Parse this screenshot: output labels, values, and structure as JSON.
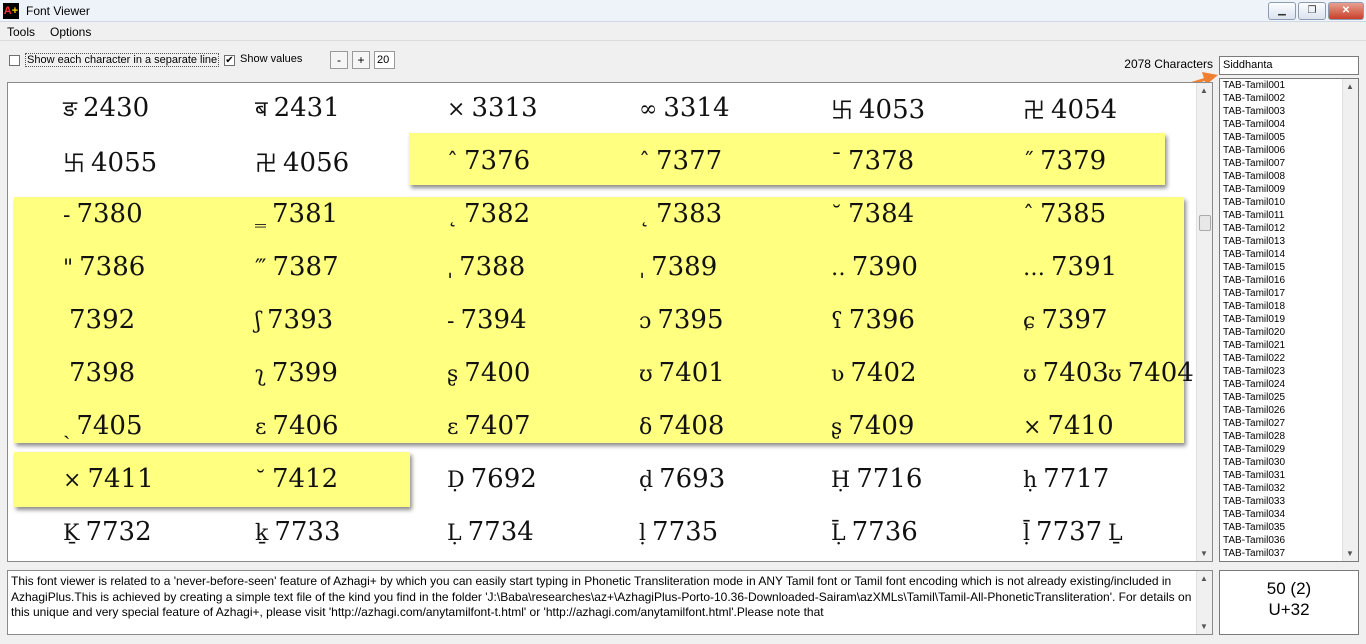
{
  "window": {
    "title": "Font Viewer",
    "app_icon": "A+"
  },
  "menu": [
    "Tools",
    "Options"
  ],
  "toolbar": {
    "separate_line_label": "Show each character in a separate line",
    "separate_line_checked": false,
    "show_values_label": "Show values",
    "show_values_checked": true,
    "minus_label": "-",
    "plus_label": "+",
    "font_size": "20"
  },
  "char_count": "2078 Characters",
  "font_name": "Siddhanta",
  "colors": {
    "highlight": "#ffff80",
    "arrow": "#f08030"
  },
  "rows": [
    [
      [
        "ङ",
        "2430"
      ],
      [
        "ब",
        "2431"
      ],
      [
        "⨯",
        "3313"
      ],
      [
        "∞",
        "3314"
      ],
      [
        "卐",
        "4053"
      ],
      [
        "卍",
        "4054"
      ]
    ],
    [
      [
        "卐",
        "4055"
      ],
      [
        "卍",
        "4056"
      ],
      [
        "ˆ",
        "7376"
      ],
      [
        "ˆ",
        "7377"
      ],
      [
        "ˉ",
        "7378"
      ],
      [
        "˝",
        "7379"
      ]
    ],
    [
      [
        "-",
        "7380"
      ],
      [
        "‗",
        "7381"
      ],
      [
        "˛",
        "7382"
      ],
      [
        "˛",
        "7383"
      ],
      [
        "˘",
        "7384"
      ],
      [
        "ˆ",
        "7385"
      ]
    ],
    [
      [
        "\"",
        "7386"
      ],
      [
        "‴",
        "7387"
      ],
      [
        "ˌ",
        "7388"
      ],
      [
        "ˌ",
        "7389"
      ],
      [
        "‥",
        "7390"
      ],
      [
        "…",
        "7391"
      ]
    ],
    [
      [
        "",
        "7392"
      ],
      [
        "ʃ",
        "7393"
      ],
      [
        "-",
        "7394"
      ],
      [
        "ɔ",
        "7395"
      ],
      [
        "ʕ",
        "7396"
      ],
      [
        "ɕ",
        "7397"
      ]
    ],
    [
      [
        "",
        "7398"
      ],
      [
        "ʅ",
        "7399"
      ],
      [
        "ʂ",
        "7400"
      ],
      [
        "ʊ",
        "7401"
      ],
      [
        "ʋ",
        "7402"
      ],
      [
        "ʊ",
        "7403"
      ],
      [
        "ʊ",
        "7404"
      ]
    ],
    [
      [
        "ˎ",
        "7405"
      ],
      [
        "ɛ",
        "7406"
      ],
      [
        "ɛ",
        "7407"
      ],
      [
        "δ",
        "7408"
      ],
      [
        "ʂ",
        "7409"
      ],
      [
        "×",
        "7410"
      ]
    ],
    [
      [
        "×",
        "7411"
      ],
      [
        "˘",
        "7412"
      ],
      [
        "Ḍ",
        "7692"
      ],
      [
        "ḍ",
        "7693"
      ],
      [
        "Ḥ",
        "7716"
      ],
      [
        "ḥ",
        "7717"
      ]
    ],
    [
      [
        "Ḵ",
        "7732"
      ],
      [
        "ḵ",
        "7733"
      ],
      [
        "Ḷ",
        "7734"
      ],
      [
        "ḷ",
        "7735"
      ],
      [
        "Ḹ",
        "7736"
      ],
      [
        "ḹ",
        "7737"
      ],
      [
        "Ḻ",
        ""
      ]
    ]
  ],
  "font_list": [
    "TAB-Tamil001",
    "TAB-Tamil002",
    "TAB-Tamil003",
    "TAB-Tamil004",
    "TAB-Tamil005",
    "TAB-Tamil006",
    "TAB-Tamil007",
    "TAB-Tamil008",
    "TAB-Tamil009",
    "TAB-Tamil010",
    "TAB-Tamil011",
    "TAB-Tamil012",
    "TAB-Tamil013",
    "TAB-Tamil014",
    "TAB-Tamil015",
    "TAB-Tamil016",
    "TAB-Tamil017",
    "TAB-Tamil018",
    "TAB-Tamil019",
    "TAB-Tamil020",
    "TAB-Tamil021",
    "TAB-Tamil022",
    "TAB-Tamil023",
    "TAB-Tamil024",
    "TAB-Tamil025",
    "TAB-Tamil026",
    "TAB-Tamil027",
    "TAB-Tamil028",
    "TAB-Tamil029",
    "TAB-Tamil030",
    "TAB-Tamil031",
    "TAB-Tamil032",
    "TAB-Tamil033",
    "TAB-Tamil034",
    "TAB-Tamil035",
    "TAB-Tamil036",
    "TAB-Tamil037"
  ],
  "info_text": "This font viewer is related to a 'never-before-seen' feature of Azhagi+ by which you can easily start typing in Phonetic Transliteration mode in ANY Tamil font or Tamil font encoding which is not already existing/included in AzhagiPlus.This is achieved by creating a simple text file of the kind you find in the folder 'J:\\Baba\\researches\\az+\\AzhagiPlus-Porto-10.36-Downloaded-Sairam\\azXMLs\\Tamil\\Tamil-All-PhoneticTransliteration'. For details on this unique and very special feature of Azhagi+, please visit 'http://azhagi.com/anytamilfont-t.html' or 'http://azhagi.com/anytamilfont.html'.Please note that",
  "value": {
    "decimal": "50 (2)",
    "unicode": "U+32"
  }
}
